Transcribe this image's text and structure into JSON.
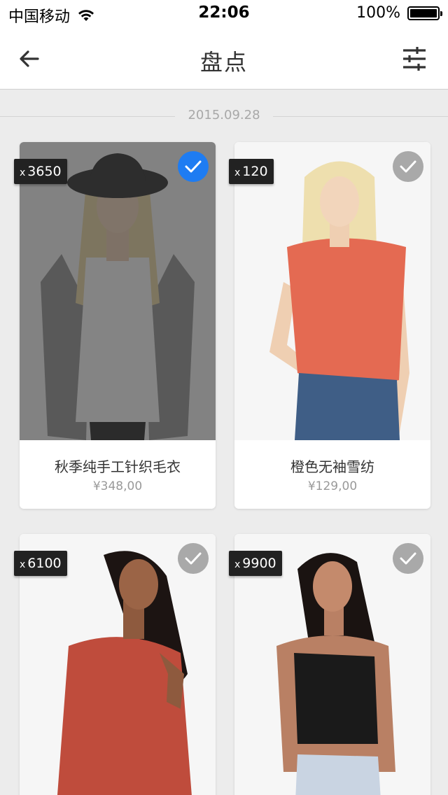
{
  "status_bar": {
    "carrier": "中国移动",
    "time": "22:06",
    "battery": "100%"
  },
  "navbar": {
    "title": "盘点",
    "back_icon": "back-arrow-icon",
    "filter_icon": "filter-sliders-icon"
  },
  "date": "2015.09.28",
  "products": [
    {
      "qty_prefix": "x",
      "qty": "3650",
      "name": "秋季纯手工针织毛衣",
      "price": "¥348,00",
      "checked": true
    },
    {
      "qty_prefix": "x",
      "qty": "120",
      "name": "橙色无袖雪纺",
      "price": "¥129,00",
      "checked": false
    },
    {
      "qty_prefix": "x",
      "qty": "6100",
      "name": "",
      "price": "",
      "checked": false
    },
    {
      "qty_prefix": "x",
      "qty": "9900",
      "name": "",
      "price": "",
      "checked": false
    }
  ],
  "colors": {
    "accent": "#1e7cf2",
    "check_off": "#a9a9a9",
    "badge": "#222222"
  }
}
